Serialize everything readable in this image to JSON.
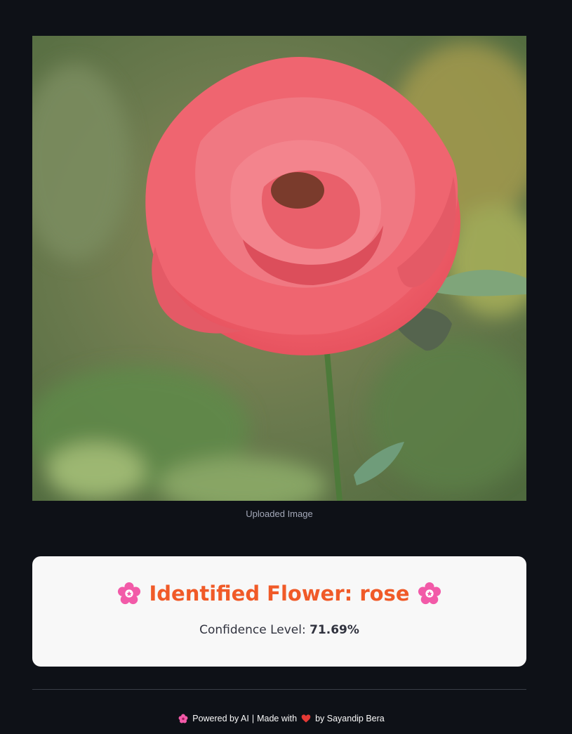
{
  "image_caption": "Uploaded Image",
  "result": {
    "title_prefix": "Identified Flower:",
    "flower_name": "rose",
    "confidence_label": "Confidence Level:",
    "confidence_value": "71.69%"
  },
  "footer": {
    "powered_text": "Powered by AI",
    "separator": "|",
    "made_with": "Made with",
    "by_text": "by Sayandip Bera"
  },
  "colors": {
    "background": "#0e1117",
    "title": "#f05a28",
    "card": "#f8f8f8",
    "blossom": "#f25aa8",
    "heart": "#e53935"
  },
  "icons": [
    "cherry-blossom-icon",
    "hibiscus-icon",
    "heart-icon"
  ]
}
